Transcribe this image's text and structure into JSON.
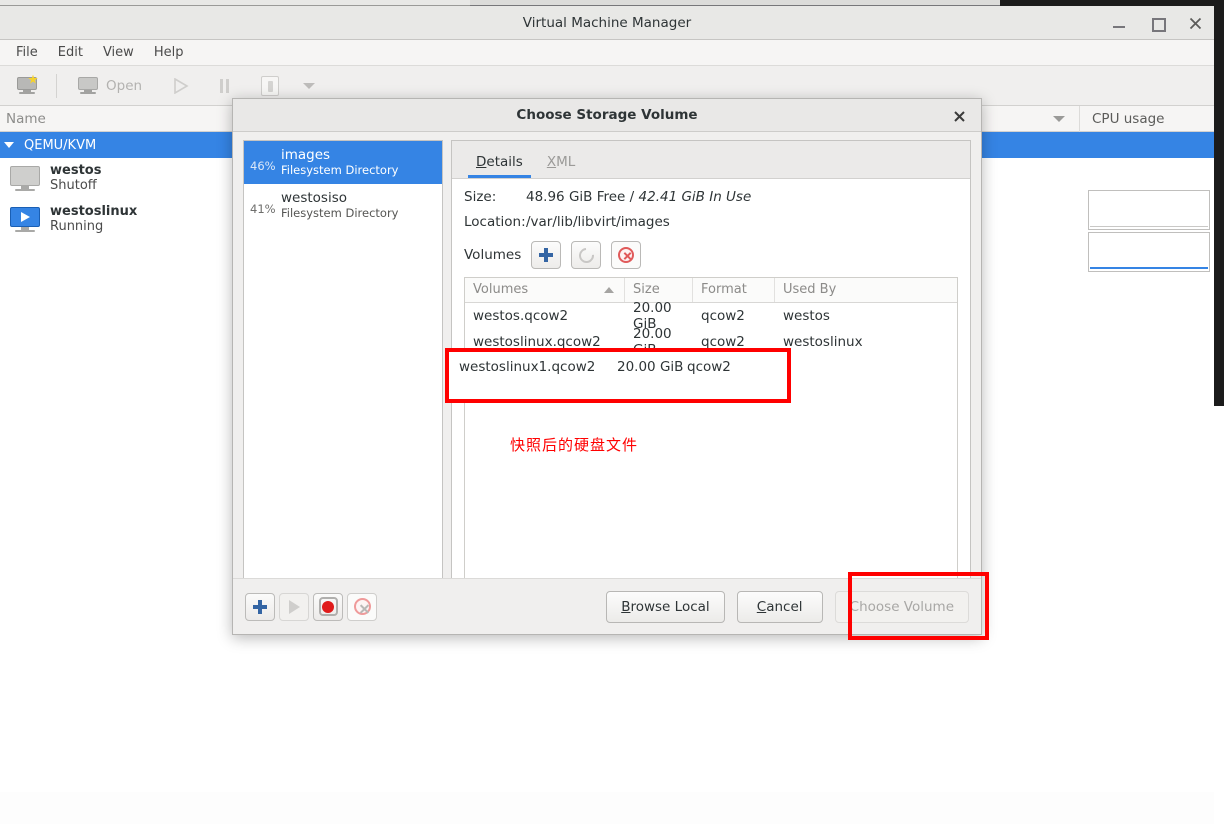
{
  "main_window": {
    "title": "Virtual Machine Manager",
    "window_controls": {
      "minimize": "minimize-icon",
      "maximize": "maximize-icon",
      "close": "close-icon"
    },
    "menubar": [
      "File",
      "Edit",
      "View",
      "Help"
    ],
    "toolbar": {
      "new_vm": "new-vm-icon",
      "open_label": "Open",
      "run_icon": "play-icon",
      "pause_icon": "pause-icon",
      "shutdown_icon": "shutdown-icon",
      "dropdown_icon": "chevron-down-icon"
    },
    "list_header": {
      "name": "Name",
      "cpu_usage": "CPU usage",
      "sort_icon": "chevron-down-icon"
    },
    "connection": {
      "label": "QEMU/KVM",
      "expander": "triangle-down-icon"
    },
    "vms": [
      {
        "name": "westos",
        "state": "Shutoff",
        "icon": "monitor-icon"
      },
      {
        "name": "westoslinux",
        "state": "Running",
        "icon": "monitor-running-icon"
      }
    ]
  },
  "dialog": {
    "title": "Choose Storage Volume",
    "close_icon": "close-icon",
    "pools": [
      {
        "percent": "46%",
        "name": "images",
        "type": "Filesystem Directory",
        "selected": true
      },
      {
        "percent": "41%",
        "name": "westosiso",
        "type": "Filesystem Directory",
        "selected": false
      }
    ],
    "tabs": [
      {
        "label": "Details",
        "mnemonic": "D",
        "active": true
      },
      {
        "label": "XML",
        "mnemonic": "X",
        "active": false
      }
    ],
    "details": {
      "size_label": "Size:",
      "size_free": "48.96 GiB Free",
      "size_sep": "/",
      "size_in_use": "42.41 GiB In Use",
      "location_label": "Location:",
      "location_value": "/var/lib/libvirt/images"
    },
    "volumes_section": {
      "label": "Volumes",
      "add_icon": "plus-icon",
      "refresh_icon": "refresh-icon",
      "delete_icon": "delete-circle-icon"
    },
    "volume_table": {
      "columns": [
        "Volumes",
        "Size",
        "Format",
        "Used By"
      ],
      "sort_column": "Volumes",
      "sort_icon": "triangle-up-icon",
      "rows": [
        {
          "name": "westos.qcow2",
          "size": "20.00 GiB",
          "format": "qcow2",
          "used_by": "westos"
        },
        {
          "name": "westoslinux.qcow2",
          "size": "20.00 GiB",
          "format": "qcow2",
          "used_by": "westoslinux"
        },
        {
          "name": "westoslinux1.qcow2",
          "size": "20.00 GiB",
          "format": "qcow2",
          "used_by": ""
        }
      ]
    },
    "pool_actions": {
      "add_pool_icon": "plus-icon",
      "start_pool_icon": "play-icon",
      "stop_pool_icon": "stop-octagon-icon",
      "delete_pool_icon": "delete-circle-icon"
    },
    "buttons": {
      "browse_local": "Browse Local",
      "browse_local_mnemonic": "B",
      "cancel": "Cancel",
      "cancel_mnemonic": "C",
      "choose_volume": "Choose Volume",
      "choose_volume_disabled": true
    }
  },
  "annotations": {
    "chinese_note": "快照后的硬盘文件",
    "highlight_color": "#ff0000",
    "boxes": [
      {
        "name": "volume-row-highlight",
        "target": "westoslinux1.qcow2"
      },
      {
        "name": "choose-volume-highlight",
        "target": "Choose Volume"
      }
    ]
  },
  "colors": {
    "accent_blue": "#3584e4",
    "window_bg": "#f6f5f4",
    "annotation_red": "#ff0000"
  }
}
